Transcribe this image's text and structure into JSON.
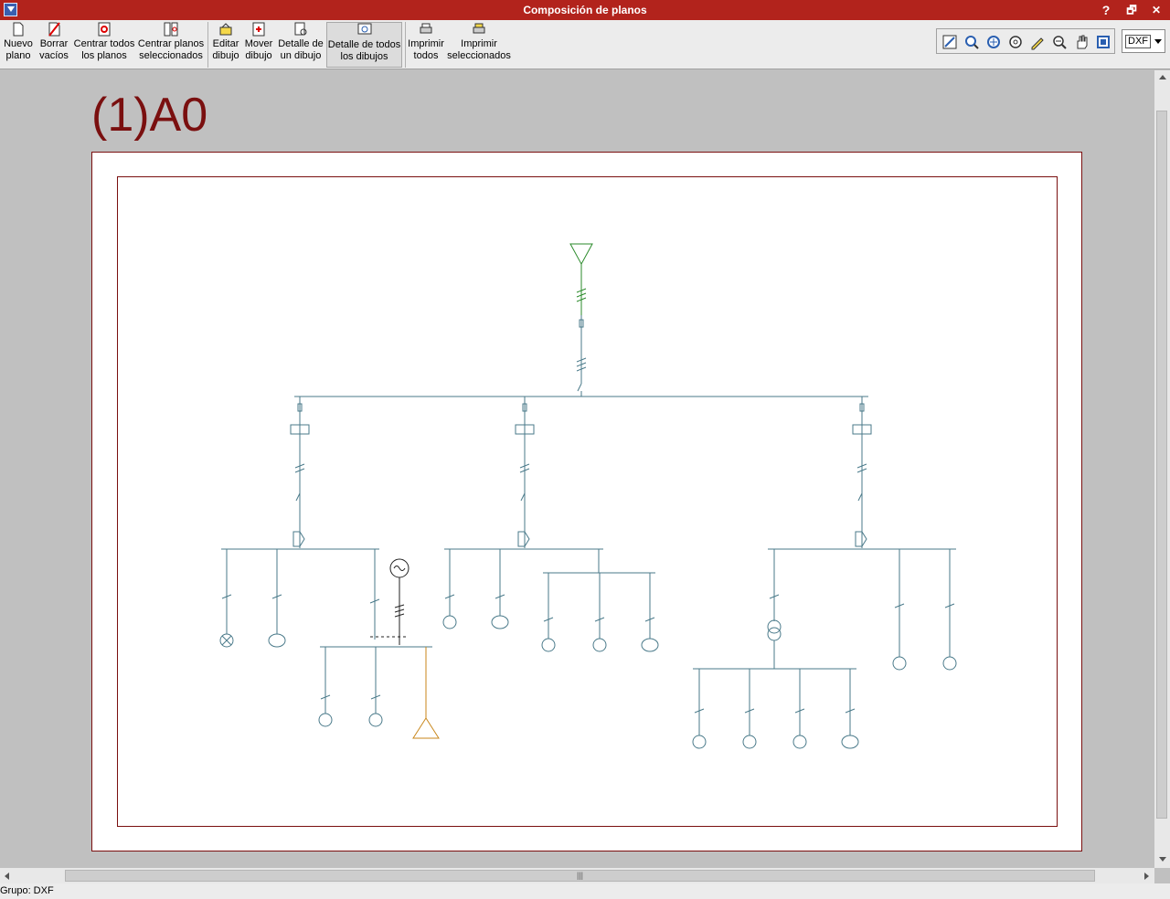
{
  "window": {
    "title": "Composición de planos",
    "help": "?",
    "restore": "🗗",
    "close": "✕"
  },
  "toolbar": {
    "items": [
      {
        "label1": "Nuevo",
        "label2": "plano"
      },
      {
        "label1": "Borrar",
        "label2": "vacíos"
      },
      {
        "label1": "Centrar todos",
        "label2": "los planos"
      },
      {
        "label1": "Centrar planos",
        "label2": "seleccionados"
      },
      {
        "label1": "Editar",
        "label2": "dibujo"
      },
      {
        "label1": "Mover",
        "label2": "dibujo"
      },
      {
        "label1": "Detalle de",
        "label2": "un dibujo"
      },
      {
        "label1": "Detalle de todos",
        "label2": "los dibujos"
      },
      {
        "label1": "Imprimir",
        "label2": "todos"
      },
      {
        "label1": "Imprimir",
        "label2": "seleccionados"
      }
    ],
    "format_select": "DXF"
  },
  "canvas": {
    "plan_label": "(1)A0"
  },
  "status": {
    "text": "Grupo: DXF"
  },
  "colors": {
    "titlebar": "#b2231c",
    "frame": "#7a0f0f",
    "wire": "#4a7a8a",
    "supply": "#2a8a2a",
    "generator": "#c8861a"
  }
}
